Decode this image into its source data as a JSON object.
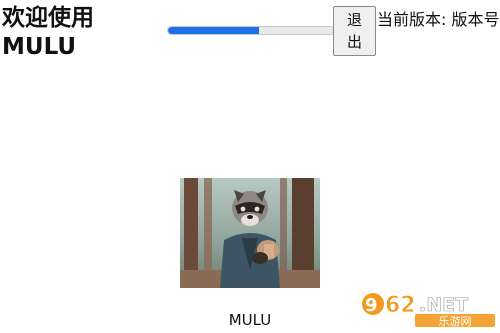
{
  "header": {
    "welcome_title": "欢迎使用MULU",
    "exit_label": "退出",
    "version_text": "当前版本: 版本号"
  },
  "progress": {
    "value_percent": 55,
    "color": "#1b72e8"
  },
  "main": {
    "image_alt": "raccoon-in-forest",
    "caption": "MULU"
  },
  "watermark": {
    "brand": "962.NET",
    "subtitle": "乐游网"
  }
}
